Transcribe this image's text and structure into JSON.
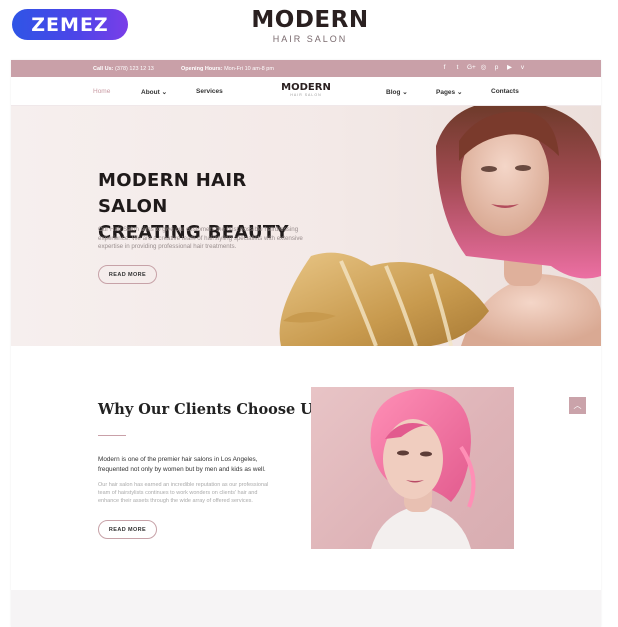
{
  "promo": {
    "brand": "ZEMEZ"
  },
  "template": {
    "title": "MODERN",
    "subtitle": "HAIR SALON"
  },
  "topbar": {
    "call_label": "Call Us:",
    "call_value": "(378) 123 12 13",
    "hours_label": "Opening Hours:",
    "hours_value": "Mon-Fri 10 am-8 pm",
    "social": [
      "facebook-icon",
      "twitter-icon",
      "google-plus-icon",
      "instagram-icon",
      "pinterest-icon",
      "youtube-icon",
      "vimeo-icon"
    ]
  },
  "nav": {
    "home": "Home",
    "about": "About",
    "services": "Services",
    "logo_title": "MODERN",
    "logo_subtitle": "HAIR SALON",
    "blog": "Blog",
    "pages": "Pages",
    "contacts": "Contacts"
  },
  "hero": {
    "title_line1": "MODERN HAIR SALON",
    "title_line2": "CREATING BEAUTY",
    "text": "Our Hair Salon aims to give our customers the best possible hairdressing experience. We are a creative team of hairstyling specialists with extensive expertise in providing professional hair treatments.",
    "button": "READ MORE"
  },
  "why": {
    "title": "Why Our Clients Choose Us",
    "lead": "Modern is one of the premier hair salons in Los Angeles, frequented not only by women but by men and kids as well.",
    "body": "Our hair salon has earned an incredible reputation as our professional team of hairstylists continues to work wonders on clients' hair and enhance their assets through the wide array of offered services.",
    "button": "READ MORE"
  },
  "colors": {
    "accent": "#c9a0a8",
    "hero_bg": "#f3e9e7",
    "promo_blue": "#2f55e6"
  }
}
